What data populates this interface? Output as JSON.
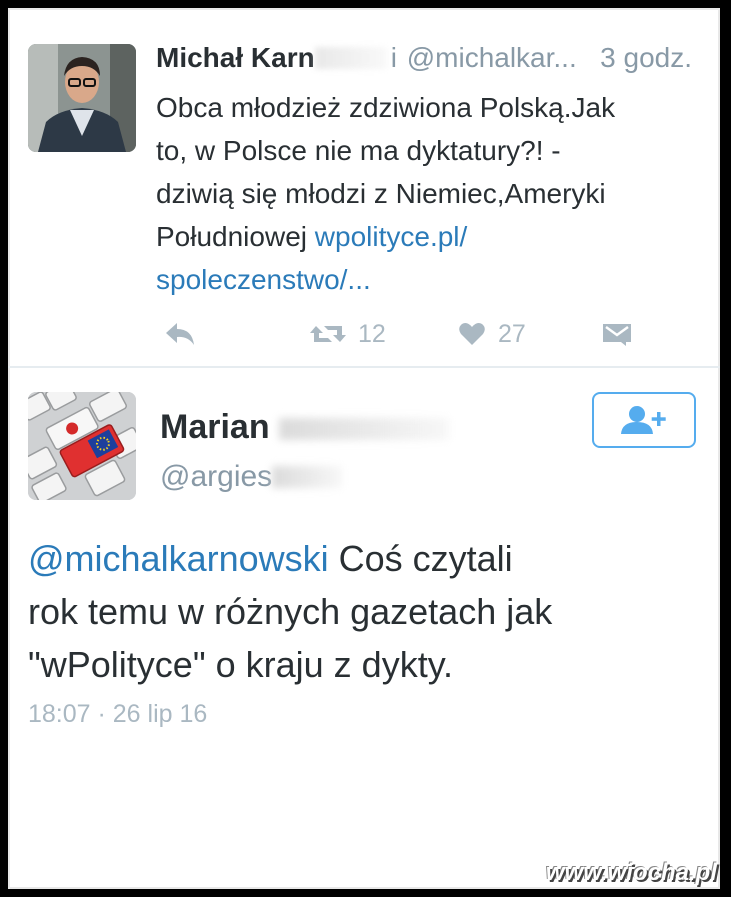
{
  "tweet1": {
    "name": "Michał Karn",
    "name_tail": "i",
    "handle": "@michalkar...",
    "time": "3 godz.",
    "text_lines": [
      "Obca młodzież zdziwiona Polską.Jak",
      "to, w Polsce nie ma dyktatury?! -",
      "dziwią się młodzi z Niemiec,Ameryki",
      "Południowej "
    ],
    "link_part1": "wpolityce.pl/",
    "link_part2": "spoleczenstwo/...",
    "retweets": "12",
    "likes": "27",
    "icons": [
      "reply-icon",
      "retweet-icon",
      "heart-icon",
      "dm-icon"
    ]
  },
  "tweet2": {
    "name": "Marian",
    "handle": "@argies",
    "mention": "@michalkarnowski",
    "text_after_mention": " Coś czytali",
    "text_line2": "rok temu w różnych gazetach jak",
    "text_line3": "\"wPolityce\" o kraju z dykty.",
    "timestamp": "18:07 · 26 lip 16",
    "follow_icon": "add-user-icon"
  },
  "watermark": "www.wiocha.pl",
  "colors": {
    "link": "#2b7bb9",
    "text": "#292f33",
    "muted": "#8899a6",
    "action": "#aab8c2",
    "follow_border": "#55acee"
  }
}
